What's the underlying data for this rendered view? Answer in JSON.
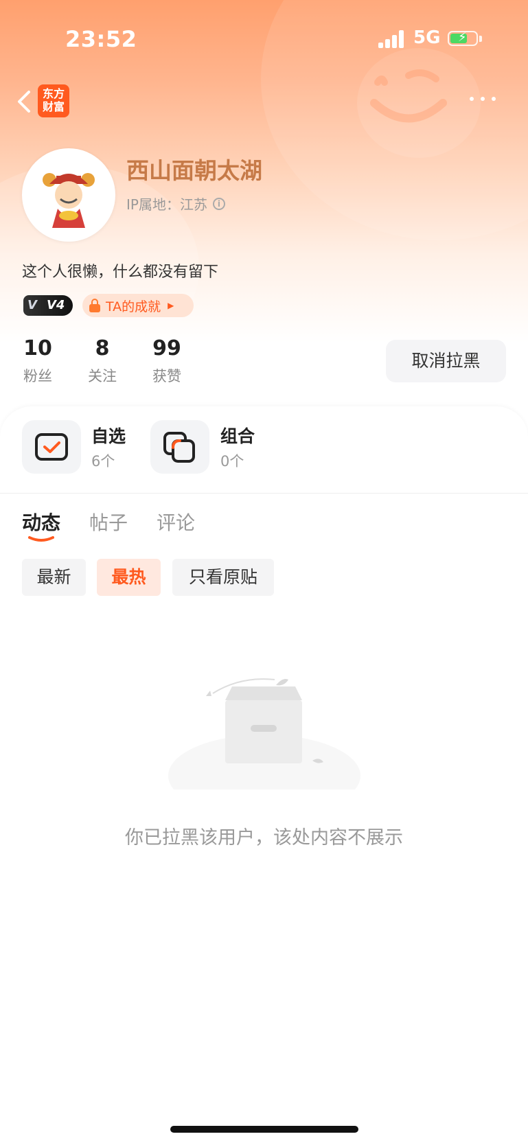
{
  "status_bar": {
    "time": "23:52",
    "network": "5G",
    "battery_icon": "battery-charging-icon",
    "signal_icon": "cellular-signal-icon"
  },
  "nav": {
    "back_icon": "chevron-left-icon",
    "app_logo": "东方\n财富",
    "more_icon": "more-dots-icon"
  },
  "profile": {
    "name": "西山面朝太湖",
    "ip_location": "IP属地：江苏",
    "bio": "这个人很懒，什么都没有留下",
    "vip_level": "V4",
    "achievement": "TA的成就",
    "stats": [
      {
        "value": "10",
        "label": "粉丝"
      },
      {
        "value": "8",
        "label": "关注"
      },
      {
        "value": "99",
        "label": "获赞"
      }
    ],
    "unblock_label": "取消拉黑"
  },
  "cards": [
    {
      "title": "自选",
      "subtitle": "6个",
      "icon": "watchlist-check-icon"
    },
    {
      "title": "组合",
      "subtitle": "0个",
      "icon": "portfolio-stack-icon"
    }
  ],
  "tabs": [
    {
      "label": "动态",
      "active": true
    },
    {
      "label": "帖子",
      "active": false
    },
    {
      "label": "评论",
      "active": false
    }
  ],
  "filters": [
    {
      "label": "最新",
      "active": false
    },
    {
      "label": "最热",
      "active": true
    },
    {
      "label": "只看原贴",
      "active": false
    }
  ],
  "empty_state": {
    "message": "你已拉黑该用户，该处内容不展示",
    "icon": "empty-box-illustration"
  },
  "colors": {
    "accent": "#ff5a1f",
    "username": "#c67a48",
    "header_top": "#ffa06e"
  }
}
